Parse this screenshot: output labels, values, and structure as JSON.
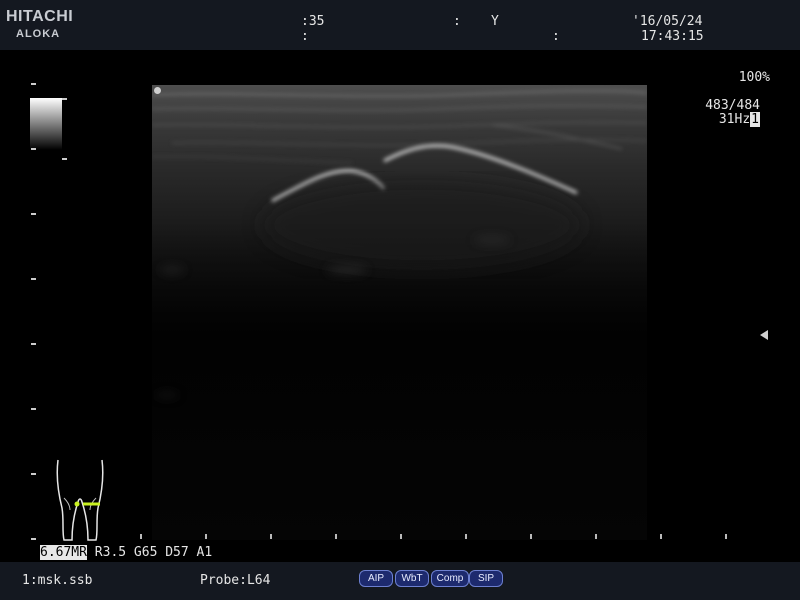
{
  "header": {
    "brand_line1": "HITACHI",
    "brand_line2": "ALOKA",
    "field1": ":35",
    "field2": ":",
    "field3": ":",
    "field4": "Y",
    "field5": ":",
    "date": "'16/05/24",
    "time": "17:43:15"
  },
  "image_info": {
    "zoom": "100%",
    "frame": "483/484",
    "frame_rate": "31Hz",
    "frame_rate_box": "1"
  },
  "params": {
    "mi": "6.67MR",
    "rest": " R3.5 G65 D57 A1"
  },
  "footer": {
    "preset": "1:msk.ssb",
    "probe": "Probe:L64",
    "buttons": [
      "AIP",
      "WbT",
      "Comp",
      "SIP"
    ]
  },
  "icons": {
    "bodymark": "legs-bodymark-icon",
    "focus": "focus-marker-icon",
    "orientation": "orientation-dot-icon"
  },
  "colors": {
    "bodymark_probe": "#c8f020",
    "button_bg": "#1d2a6e",
    "button_border": "#6c7fd0"
  }
}
